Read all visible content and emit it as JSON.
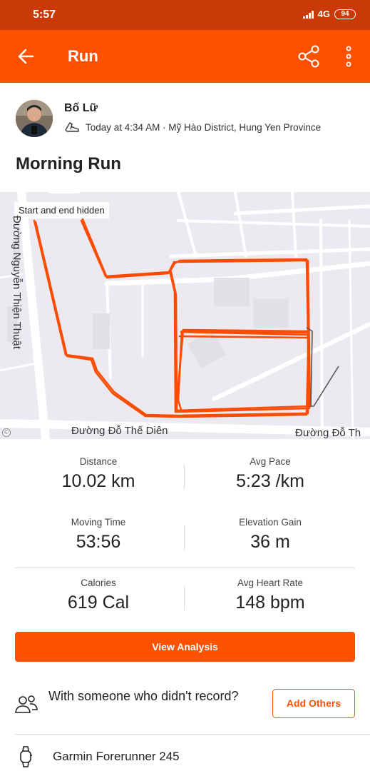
{
  "status_bar": {
    "time": "5:57",
    "network": "4G",
    "battery": "94"
  },
  "app_bar": {
    "title": "Run",
    "back_icon": "arrow-left-icon",
    "share_icon": "share-icon",
    "more_icon": "more-vertical-icon",
    "color": "#fc5200"
  },
  "athlete": {
    "name": "Bố Lữ",
    "meta": "Today at 4:34 AM · Mỹ Hào District, Hung Yen Province"
  },
  "activity": {
    "title": "Morning Run"
  },
  "map": {
    "privacy_chip": "Start and end hidden",
    "streets": {
      "vertical": "Đường Nguyễn Thiện Thuật",
      "bottom": "Đường Đỗ Thế Diên",
      "bottom_right": "Đường Đỗ Th"
    },
    "route_color": "#fc4c02"
  },
  "stats": [
    {
      "label": "Distance",
      "value": "10.02 km"
    },
    {
      "label": "Avg Pace",
      "value": "5:23 /km"
    },
    {
      "label": "Moving Time",
      "value": "53:56"
    },
    {
      "label": "Elevation Gain",
      "value": "36 m"
    },
    {
      "label": "Calories",
      "value": "619 Cal"
    },
    {
      "label": "Avg Heart Rate",
      "value": "148 bpm"
    }
  ],
  "actions": {
    "view_analysis": "View Analysis",
    "with_someone": "With someone who didn't record?",
    "add_others": "Add Others"
  },
  "device": {
    "name": "Garmin Forerunner 245"
  }
}
